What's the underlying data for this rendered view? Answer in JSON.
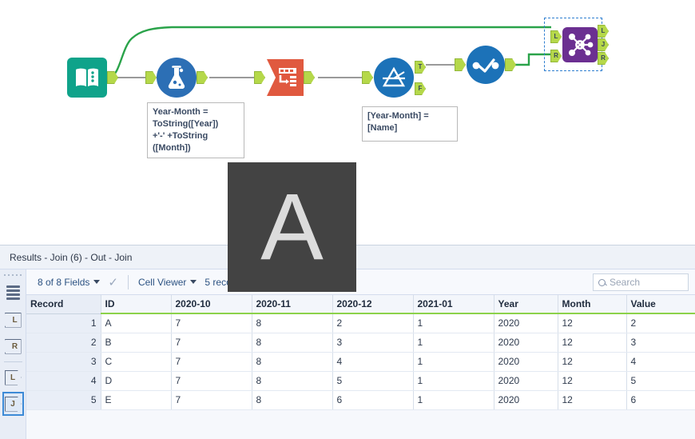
{
  "canvas": {
    "tools": [
      {
        "name": "input-data",
        "label": "Input Data",
        "color": "#0fa38a",
        "icon": "book-icon"
      },
      {
        "name": "formula",
        "label": "Formula",
        "color": "#2c6fb5",
        "icon": "flask-icon"
      },
      {
        "name": "transpose",
        "label": "Transpose",
        "color": "#e0593f",
        "icon": "transpose-icon"
      },
      {
        "name": "filter",
        "label": "Filter",
        "color": "#2c6fb5",
        "icon": "filter-funnel-icon"
      },
      {
        "name": "select",
        "label": "Select",
        "color": "#1c72b8",
        "icon": "select-check-icon"
      },
      {
        "name": "join",
        "label": "Join",
        "color": "#6b2f91",
        "icon": "join-node-icon"
      }
    ],
    "anchors": {
      "filter_true": "T",
      "filter_false": "F",
      "join_in_left": "L",
      "join_in_right": "R",
      "join_out_left": "L",
      "join_out_join": "J",
      "join_out_right": "R"
    },
    "annotations": [
      {
        "name": "formula-annotation",
        "text": "Year-Month =\nToString([Year])\n+'-' +ToString\n([Month])"
      },
      {
        "name": "filter-annotation",
        "text": "[Year-Month] =\n[Name]"
      }
    ],
    "wire_color": "#2aa34a",
    "wire_color_gray": "#9a9a9a"
  },
  "watermark": {
    "letter": "A"
  },
  "results": {
    "title": "Results - Join (6) - Out - Join",
    "toolbar": {
      "fields_label": "8 of 8 Fields",
      "cell_viewer_label": "Cell Viewer",
      "records_label": "5 records displayed",
      "up_arrow": "↑",
      "down_arrow": "↓",
      "check": "✓"
    },
    "search": {
      "placeholder": "Search"
    },
    "rail": [
      {
        "name": "rail-records",
        "label": ""
      },
      {
        "name": "rail-sigma-left",
        "label": "L"
      },
      {
        "name": "rail-sigma-right",
        "label": "R"
      },
      {
        "name": "rail-anchor-left",
        "label": "L"
      },
      {
        "name": "rail-anchor-join",
        "label": "J"
      }
    ],
    "grid": {
      "columns": [
        "Record",
        "ID",
        "2020-10",
        "2020-11",
        "2020-12",
        "2021-01",
        "Year",
        "Month",
        "Value"
      ],
      "rows": [
        [
          "1",
          "A",
          "7",
          "8",
          "2",
          "1",
          "2020",
          "12",
          "2"
        ],
        [
          "2",
          "B",
          "7",
          "8",
          "3",
          "1",
          "2020",
          "12",
          "3"
        ],
        [
          "3",
          "C",
          "7",
          "8",
          "4",
          "1",
          "2020",
          "12",
          "4"
        ],
        [
          "4",
          "D",
          "7",
          "8",
          "5",
          "1",
          "2020",
          "12",
          "5"
        ],
        [
          "5",
          "E",
          "7",
          "8",
          "6",
          "1",
          "2020",
          "12",
          "6"
        ]
      ]
    }
  }
}
